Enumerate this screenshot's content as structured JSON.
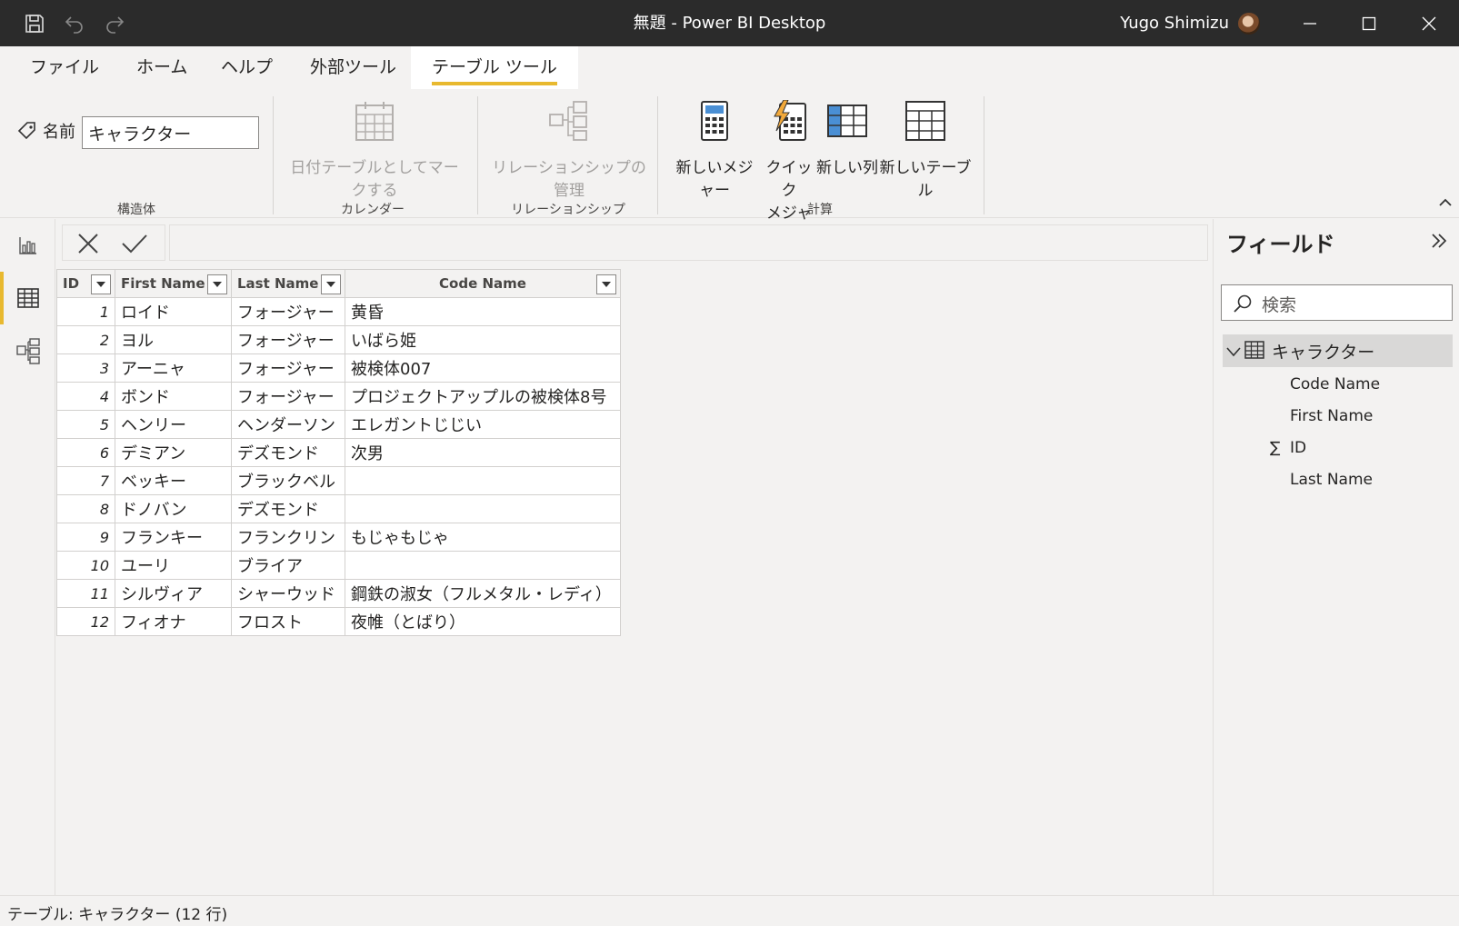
{
  "titlebar": {
    "title": "無題 - Power BI Desktop",
    "user": "Yugo Shimizu",
    "icons": [
      "save-icon",
      "undo-icon",
      "redo-icon",
      "minimize-icon",
      "maximize-icon",
      "close-icon"
    ]
  },
  "ribbon_tabs": [
    {
      "label": "ファイル"
    },
    {
      "label": "ホーム"
    },
    {
      "label": "ヘルプ"
    },
    {
      "label": "外部ツール"
    },
    {
      "label": "テーブル ツール",
      "active": true
    }
  ],
  "ribbon": {
    "name_label": "名前",
    "name_value": "キャラクター",
    "groups": {
      "structure": "構造体",
      "calendar": "カレンダー",
      "relationships": "リレーションシップ",
      "calculations": "計算"
    },
    "buttons": {
      "mark_date_table": "日付テーブルとしてマークする",
      "manage_relationships": "リレーションシップの管理",
      "new_measure": "新しいメジャー",
      "quick_measure_1": "クイック",
      "quick_measure_2": "メジャー",
      "new_column": "新しい列",
      "new_table": "新しいテーブル"
    }
  },
  "grid": {
    "columns": [
      "ID",
      "First Name",
      "Last Name",
      "Code Name"
    ],
    "rows": [
      {
        "id": "1",
        "first": "ロイド",
        "last": "フォージャー",
        "code": "黄昏"
      },
      {
        "id": "2",
        "first": "ヨル",
        "last": "フォージャー",
        "code": "いばら姫"
      },
      {
        "id": "3",
        "first": "アーニャ",
        "last": "フォージャー",
        "code": "被検体007"
      },
      {
        "id": "4",
        "first": "ボンド",
        "last": "フォージャー",
        "code": "プロジェクトアップルの被検体8号"
      },
      {
        "id": "5",
        "first": "ヘンリー",
        "last": "ヘンダーソン",
        "code": "エレガントじじい"
      },
      {
        "id": "6",
        "first": "デミアン",
        "last": "デズモンド",
        "code": "次男"
      },
      {
        "id": "7",
        "first": "ベッキー",
        "last": "ブラックベル",
        "code": ""
      },
      {
        "id": "8",
        "first": "ドノバン",
        "last": "デズモンド",
        "code": ""
      },
      {
        "id": "9",
        "first": "フランキー",
        "last": "フランクリン",
        "code": "もじゃもじゃ"
      },
      {
        "id": "10",
        "first": "ユーリ",
        "last": "ブライア",
        "code": ""
      },
      {
        "id": "11",
        "first": "シルヴィア",
        "last": "シャーウッド",
        "code": "鋼鉄の淑女（フルメタル・レディ）"
      },
      {
        "id": "12",
        "first": "フィオナ",
        "last": "フロスト",
        "code": "夜帷（とばり）"
      }
    ]
  },
  "fields_pane": {
    "title": "フィールド",
    "search_placeholder": "検索",
    "table_name": "キャラクター",
    "fields": [
      {
        "name": "Code Name",
        "sigma": false
      },
      {
        "name": "First Name",
        "sigma": false
      },
      {
        "name": "ID",
        "sigma": true
      },
      {
        "name": "Last Name",
        "sigma": false
      }
    ]
  },
  "statusbar": {
    "text": "テーブル: キャラクター (12 行)"
  },
  "colors": {
    "titlebar_bg": "#2b2b2b",
    "accent": "#e8b92f",
    "background": "#f3f2f1"
  }
}
